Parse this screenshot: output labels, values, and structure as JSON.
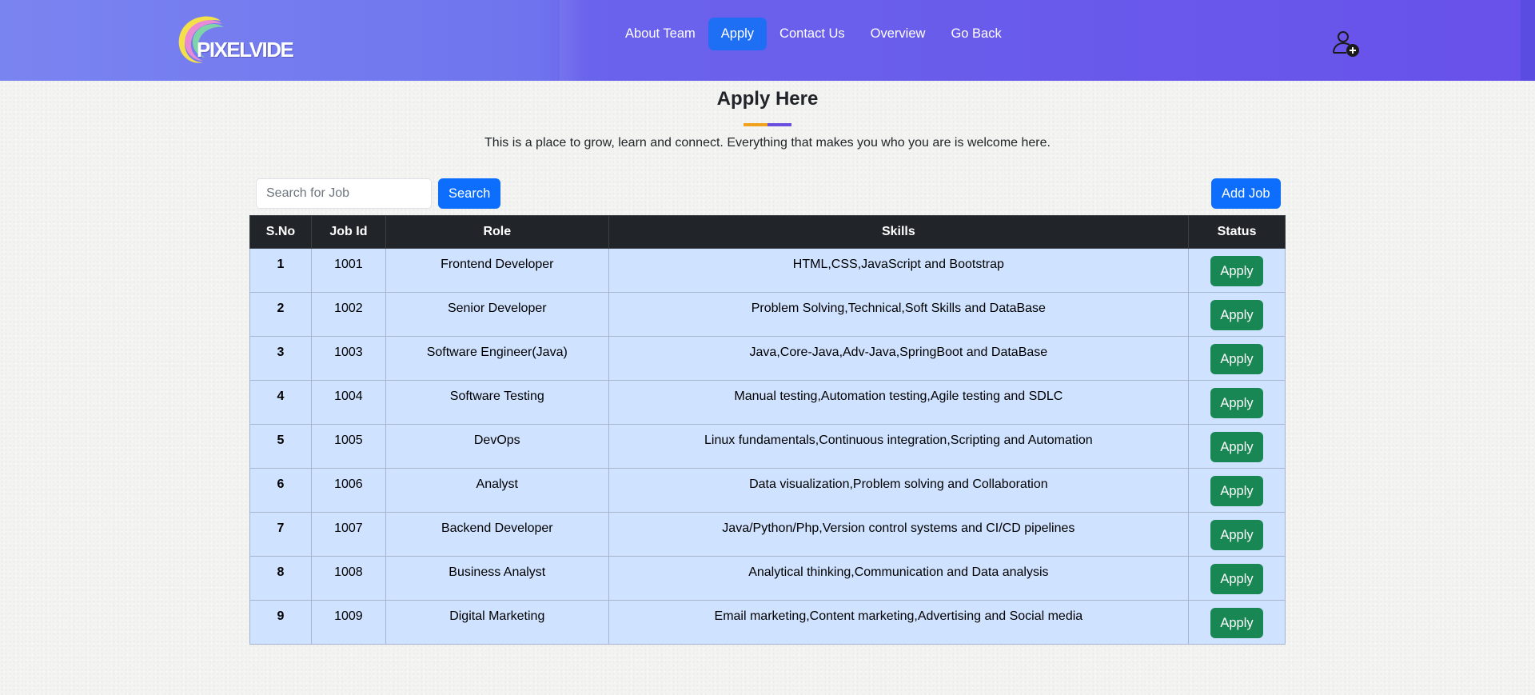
{
  "navbar": {
    "logo_text": "PIXELVIDE",
    "links": [
      {
        "label": "About Team",
        "active": false
      },
      {
        "label": "Apply",
        "active": true
      },
      {
        "label": "Contact Us",
        "active": false
      },
      {
        "label": "Overview",
        "active": false
      },
      {
        "label": "Go Back",
        "active": false
      }
    ],
    "user_icon": "user-add-icon"
  },
  "header": {
    "title": "Apply Here",
    "subtitle": "This is a place to grow, learn and connect. Everything that makes you who you are is welcome here."
  },
  "toolbar": {
    "search_placeholder": "Search for Job",
    "search_label": "Search",
    "add_label": "Add Job"
  },
  "table": {
    "columns": [
      "S.No",
      "Job Id",
      "Role",
      "Skills",
      "Status"
    ],
    "rows": [
      {
        "sno": "1",
        "job_id": "1001",
        "role": "Frontend Developer",
        "skills": "HTML,CSS,JavaScript and Bootstrap",
        "action": "Apply"
      },
      {
        "sno": "2",
        "job_id": "1002",
        "role": "Senior Developer",
        "skills": "Problem Solving,Technical,Soft Skills and DataBase",
        "action": "Apply"
      },
      {
        "sno": "3",
        "job_id": "1003",
        "role": "Software Engineer(Java)",
        "skills": "Java,Core-Java,Adv-Java,SpringBoot and DataBase",
        "action": "Apply"
      },
      {
        "sno": "4",
        "job_id": "1004",
        "role": "Software Testing",
        "skills": "Manual testing,Automation testing,Agile testing and SDLC",
        "action": "Apply"
      },
      {
        "sno": "5",
        "job_id": "1005",
        "role": "DevOps",
        "skills": "Linux fundamentals,Continuous integration,Scripting and Automation",
        "action": "Apply"
      },
      {
        "sno": "6",
        "job_id": "1006",
        "role": "Analyst",
        "skills": "Data visualization,Problem solving and Collaboration",
        "action": "Apply"
      },
      {
        "sno": "7",
        "job_id": "1007",
        "role": "Backend Developer",
        "skills": "Java/Python/Php,Version control systems and CI/CD pipelines",
        "action": "Apply"
      },
      {
        "sno": "8",
        "job_id": "1008",
        "role": "Business Analyst",
        "skills": "Analytical thinking,Communication and Data analysis",
        "action": "Apply"
      },
      {
        "sno": "9",
        "job_id": "1009",
        "role": "Digital Marketing",
        "skills": "Email marketing,Content marketing,Advertising and Social media",
        "action": "Apply"
      }
    ]
  },
  "colors": {
    "navbar": "#6c63ec",
    "active_link": "#1f6ff4",
    "primary_button": "#0d6efd",
    "apply_button": "#198754",
    "table_header": "#212529",
    "table_row": "#cfe2ff",
    "underline_left": "#f0a21c",
    "underline_right": "#6a4ee0"
  }
}
